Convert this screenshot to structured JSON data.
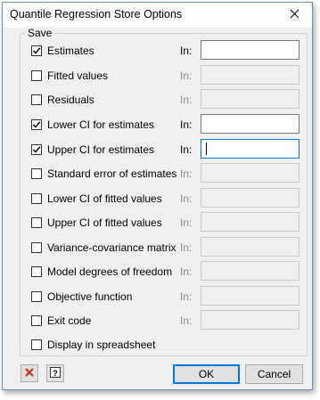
{
  "window": {
    "title": "Quantile Regression Store Options"
  },
  "group": {
    "label": "Save"
  },
  "rows": [
    {
      "label": "Estimates",
      "checked": true,
      "in_label": "In:",
      "enabled": true,
      "value": ""
    },
    {
      "label": "Fitted values",
      "checked": false,
      "in_label": "In:",
      "enabled": false,
      "value": ""
    },
    {
      "label": "Residuals",
      "checked": false,
      "in_label": "In:",
      "enabled": false,
      "value": ""
    },
    {
      "label": "Lower CI for estimates",
      "checked": true,
      "in_label": "In:",
      "enabled": true,
      "value": ""
    },
    {
      "label": "Upper CI for estimates",
      "checked": true,
      "in_label": "In:",
      "enabled": true,
      "focused": true,
      "value": ""
    },
    {
      "label": "Standard error of estimates",
      "checked": false,
      "in_label": "In:",
      "enabled": false,
      "value": ""
    },
    {
      "label": "Lower CI of fitted values",
      "checked": false,
      "in_label": "In:",
      "enabled": false,
      "value": ""
    },
    {
      "label": "Upper CI of fitted values",
      "checked": false,
      "in_label": "In:",
      "enabled": false,
      "value": ""
    },
    {
      "label": "Variance-covariance matrix",
      "checked": false,
      "in_label": "In:",
      "enabled": false,
      "value": ""
    },
    {
      "label": "Model degrees of freedom",
      "checked": false,
      "in_label": "In:",
      "enabled": false,
      "value": ""
    },
    {
      "label": "Objective function",
      "checked": false,
      "in_label": "In:",
      "enabled": false,
      "value": ""
    },
    {
      "label": "Exit code",
      "checked": false,
      "in_label": "In:",
      "enabled": false,
      "value": ""
    }
  ],
  "spreadsheet": {
    "label": "Display in spreadsheet",
    "checked": false
  },
  "buttons": {
    "ok": "OK",
    "cancel": "Cancel"
  },
  "icons": {
    "close": "close-icon",
    "clear": "clear-x-icon",
    "help": "help-icon"
  },
  "colors": {
    "accent": "#0078d7",
    "clear_icon": "#c42b1c"
  }
}
